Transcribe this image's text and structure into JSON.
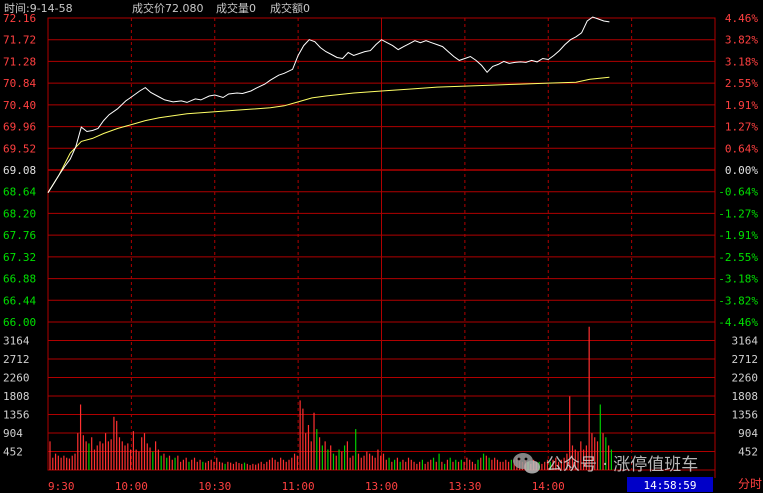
{
  "header": {
    "time_label": "时间:9-14-58",
    "price_label": "成交价72.080",
    "volume_label": "成交量0",
    "amount_label": "成交额0"
  },
  "footer": {
    "time_display": "14:58:59",
    "mode_label": "分时"
  },
  "watermark": {
    "text": "公众号 · 涨停值班车",
    "icon": "wechat-icon"
  },
  "colors": {
    "background": "#000000",
    "grid": "#b00000",
    "up": "#ff4040",
    "down": "#00e000",
    "base": "#e0e0e0",
    "price_line": "#ffffff",
    "avg_line": "#ffff66",
    "vol_up": "#ff3030",
    "vol_down": "#00d000",
    "time_box": "#0000c8"
  },
  "chart_data": {
    "type": "line",
    "base_price": 69.08,
    "price_ticks": [
      "72.16",
      "71.72",
      "71.28",
      "70.84",
      "70.40",
      "69.96",
      "69.52",
      "69.08",
      "68.64",
      "68.20",
      "67.76",
      "67.32",
      "66.88",
      "66.44",
      "66.00"
    ],
    "pct_ticks": [
      "4.46%",
      "3.82%",
      "3.18%",
      "2.55%",
      "1.91%",
      "1.27%",
      "0.64%",
      "0.00%",
      "-0.64%",
      "-1.27%",
      "-1.91%",
      "-2.55%",
      "-3.18%",
      "-3.82%",
      "-4.46%"
    ],
    "ylim": [
      66.0,
      72.16
    ],
    "volume_ticks": [
      "3164",
      "2712",
      "2260",
      "1808",
      "1356",
      "904",
      "452"
    ],
    "volume_ylim": [
      0,
      3616
    ],
    "time_ticks": [
      "9:30",
      "10:00",
      "10:30",
      "11:00",
      "13:00",
      "13:30",
      "14:00"
    ],
    "x_minutes_range": [
      0,
      240
    ],
    "series": [
      {
        "key": "price",
        "points": [
          [
            0,
            68.62
          ],
          [
            2,
            68.8
          ],
          [
            4,
            68.98
          ],
          [
            6,
            69.15
          ],
          [
            8,
            69.3
          ],
          [
            10,
            69.55
          ],
          [
            12,
            69.95
          ],
          [
            14,
            69.86
          ],
          [
            16,
            69.88
          ],
          [
            18,
            69.92
          ],
          [
            20,
            70.08
          ],
          [
            22,
            70.2
          ],
          [
            25,
            70.32
          ],
          [
            28,
            70.48
          ],
          [
            30,
            70.56
          ],
          [
            33,
            70.68
          ],
          [
            35,
            70.75
          ],
          [
            37,
            70.65
          ],
          [
            40,
            70.56
          ],
          [
            42,
            70.5
          ],
          [
            45,
            70.46
          ],
          [
            48,
            70.48
          ],
          [
            50,
            70.45
          ],
          [
            53,
            70.52
          ],
          [
            55,
            70.5
          ],
          [
            58,
            70.58
          ],
          [
            60,
            70.6
          ],
          [
            63,
            70.55
          ],
          [
            65,
            70.62
          ],
          [
            68,
            70.64
          ],
          [
            70,
            70.63
          ],
          [
            73,
            70.68
          ],
          [
            75,
            70.74
          ],
          [
            78,
            70.82
          ],
          [
            80,
            70.9
          ],
          [
            83,
            71.0
          ],
          [
            85,
            71.04
          ],
          [
            88,
            71.12
          ],
          [
            90,
            71.4
          ],
          [
            92,
            71.6
          ],
          [
            94,
            71.72
          ],
          [
            96,
            71.68
          ],
          [
            98,
            71.56
          ],
          [
            100,
            71.48
          ],
          [
            102,
            71.42
          ],
          [
            104,
            71.36
          ],
          [
            106,
            71.34
          ],
          [
            108,
            71.46
          ],
          [
            110,
            71.4
          ],
          [
            112,
            71.44
          ],
          [
            114,
            71.48
          ],
          [
            116,
            71.5
          ],
          [
            118,
            71.62
          ],
          [
            120,
            71.72
          ],
          [
            122,
            71.66
          ],
          [
            124,
            71.6
          ],
          [
            126,
            71.52
          ],
          [
            128,
            71.58
          ],
          [
            130,
            71.64
          ],
          [
            132,
            71.7
          ],
          [
            134,
            71.66
          ],
          [
            136,
            71.7
          ],
          [
            138,
            71.66
          ],
          [
            140,
            71.62
          ],
          [
            142,
            71.58
          ],
          [
            144,
            71.48
          ],
          [
            146,
            71.38
          ],
          [
            148,
            71.3
          ],
          [
            150,
            71.34
          ],
          [
            152,
            71.38
          ],
          [
            154,
            71.3
          ],
          [
            156,
            71.2
          ],
          [
            158,
            71.06
          ],
          [
            160,
            71.18
          ],
          [
            162,
            71.22
          ],
          [
            164,
            71.28
          ],
          [
            166,
            71.24
          ],
          [
            168,
            71.26
          ],
          [
            170,
            71.27
          ],
          [
            172,
            71.26
          ],
          [
            174,
            71.3
          ],
          [
            176,
            71.27
          ],
          [
            178,
            71.34
          ],
          [
            180,
            71.32
          ],
          [
            182,
            71.4
          ],
          [
            184,
            71.5
          ],
          [
            186,
            71.62
          ],
          [
            188,
            71.72
          ],
          [
            190,
            71.78
          ],
          [
            192,
            71.86
          ],
          [
            194,
            72.1
          ],
          [
            196,
            72.18
          ],
          [
            198,
            72.14
          ],
          [
            200,
            72.1
          ],
          [
            202,
            72.08
          ]
        ]
      },
      {
        "key": "average",
        "points": [
          [
            0,
            68.62
          ],
          [
            4,
            68.98
          ],
          [
            8,
            69.42
          ],
          [
            12,
            69.66
          ],
          [
            16,
            69.72
          ],
          [
            20,
            69.82
          ],
          [
            25,
            69.92
          ],
          [
            30,
            70.0
          ],
          [
            35,
            70.08
          ],
          [
            40,
            70.14
          ],
          [
            50,
            70.22
          ],
          [
            60,
            70.26
          ],
          [
            70,
            70.3
          ],
          [
            80,
            70.34
          ],
          [
            85,
            70.38
          ],
          [
            90,
            70.46
          ],
          [
            95,
            70.54
          ],
          [
            100,
            70.58
          ],
          [
            110,
            70.64
          ],
          [
            120,
            70.68
          ],
          [
            130,
            70.72
          ],
          [
            140,
            70.76
          ],
          [
            150,
            70.78
          ],
          [
            160,
            70.8
          ],
          [
            170,
            70.82
          ],
          [
            180,
            70.84
          ],
          [
            190,
            70.86
          ],
          [
            195,
            70.92
          ],
          [
            202,
            70.96
          ]
        ]
      }
    ],
    "volume_bars": [
      [
        0,
        700
      ],
      [
        1,
        300
      ],
      [
        2,
        400
      ],
      [
        3,
        350
      ],
      [
        4,
        300
      ],
      [
        5,
        350
      ],
      [
        6,
        300
      ],
      [
        7,
        280
      ],
      [
        8,
        350
      ],
      [
        9,
        400
      ],
      [
        10,
        900
      ],
      [
        11,
        1600
      ],
      [
        12,
        850
      ],
      [
        13,
        700
      ],
      [
        14,
        650
      ],
      [
        15,
        800
      ],
      [
        16,
        500
      ],
      [
        17,
        600
      ],
      [
        18,
        700
      ],
      [
        19,
        650
      ],
      [
        20,
        900
      ],
      [
        21,
        700
      ],
      [
        22,
        750
      ],
      [
        23,
        1300
      ],
      [
        24,
        1200
      ],
      [
        25,
        800
      ],
      [
        26,
        700
      ],
      [
        27,
        600
      ],
      [
        28,
        650
      ],
      [
        29,
        500
      ],
      [
        30,
        950
      ],
      [
        31,
        500
      ],
      [
        32,
        450
      ],
      [
        33,
        800
      ],
      [
        34,
        900
      ],
      [
        35,
        650
      ],
      [
        36,
        550
      ],
      [
        37,
        450
      ],
      [
        38,
        700
      ],
      [
        39,
        500
      ],
      [
        40,
        350
      ],
      [
        41,
        400
      ],
      [
        42,
        300
      ],
      [
        43,
        350
      ],
      [
        44,
        250
      ],
      [
        45,
        300
      ],
      [
        46,
        350
      ],
      [
        47,
        200
      ],
      [
        48,
        250
      ],
      [
        49,
        300
      ],
      [
        50,
        200
      ],
      [
        51,
        250
      ],
      [
        52,
        300
      ],
      [
        53,
        200
      ],
      [
        54,
        250
      ],
      [
        55,
        200
      ],
      [
        56,
        180
      ],
      [
        57,
        220
      ],
      [
        58,
        250
      ],
      [
        59,
        200
      ],
      [
        60,
        300
      ],
      [
        61,
        200
      ],
      [
        62,
        180
      ],
      [
        63,
        150
      ],
      [
        64,
        200
      ],
      [
        65,
        180
      ],
      [
        66,
        150
      ],
      [
        67,
        200
      ],
      [
        68,
        170
      ],
      [
        69,
        150
      ],
      [
        70,
        180
      ],
      [
        71,
        150
      ],
      [
        72,
        120
      ],
      [
        73,
        150
      ],
      [
        74,
        130
      ],
      [
        75,
        160
      ],
      [
        76,
        200
      ],
      [
        77,
        150
      ],
      [
        78,
        200
      ],
      [
        79,
        250
      ],
      [
        80,
        300
      ],
      [
        81,
        250
      ],
      [
        82,
        200
      ],
      [
        83,
        300
      ],
      [
        84,
        250
      ],
      [
        85,
        200
      ],
      [
        86,
        250
      ],
      [
        87,
        300
      ],
      [
        88,
        400
      ],
      [
        89,
        350
      ],
      [
        90,
        1700
      ],
      [
        91,
        1500
      ],
      [
        92,
        900
      ],
      [
        93,
        1100
      ],
      [
        94,
        700
      ],
      [
        95,
        1400
      ],
      [
        96,
        1000
      ],
      [
        97,
        800
      ],
      [
        98,
        600
      ],
      [
        99,
        700
      ],
      [
        100,
        500
      ],
      [
        101,
        600
      ],
      [
        102,
        400
      ],
      [
        103,
        350
      ],
      [
        104,
        500
      ],
      [
        105,
        450
      ],
      [
        106,
        600
      ],
      [
        107,
        700
      ],
      [
        108,
        300
      ],
      [
        109,
        350
      ],
      [
        110,
        1000
      ],
      [
        111,
        400
      ],
      [
        112,
        300
      ],
      [
        113,
        350
      ],
      [
        114,
        450
      ],
      [
        115,
        400
      ],
      [
        116,
        350
      ],
      [
        117,
        300
      ],
      [
        118,
        500
      ],
      [
        119,
        350
      ],
      [
        120,
        400
      ],
      [
        121,
        250
      ],
      [
        122,
        300
      ],
      [
        123,
        200
      ],
      [
        124,
        250
      ],
      [
        125,
        300
      ],
      [
        126,
        200
      ],
      [
        127,
        250
      ],
      [
        128,
        200
      ],
      [
        129,
        300
      ],
      [
        130,
        250
      ],
      [
        131,
        200
      ],
      [
        132,
        150
      ],
      [
        133,
        200
      ],
      [
        134,
        250
      ],
      [
        135,
        150
      ],
      [
        136,
        200
      ],
      [
        137,
        250
      ],
      [
        138,
        300
      ],
      [
        139,
        200
      ],
      [
        140,
        400
      ],
      [
        141,
        200
      ],
      [
        142,
        150
      ],
      [
        143,
        250
      ],
      [
        144,
        300
      ],
      [
        145,
        200
      ],
      [
        146,
        250
      ],
      [
        147,
        200
      ],
      [
        148,
        250
      ],
      [
        149,
        200
      ],
      [
        150,
        300
      ],
      [
        151,
        250
      ],
      [
        152,
        200
      ],
      [
        153,
        150
      ],
      [
        154,
        250
      ],
      [
        155,
        300
      ],
      [
        156,
        400
      ],
      [
        157,
        350
      ],
      [
        158,
        300
      ],
      [
        159,
        250
      ],
      [
        160,
        300
      ],
      [
        161,
        250
      ],
      [
        162,
        200
      ],
      [
        163,
        200
      ],
      [
        164,
        250
      ],
      [
        165,
        200
      ],
      [
        166,
        250
      ],
      [
        167,
        250
      ],
      [
        168,
        300
      ],
      [
        169,
        300
      ],
      [
        170,
        200
      ],
      [
        171,
        250
      ],
      [
        172,
        200
      ],
      [
        173,
        150
      ],
      [
        174,
        250
      ],
      [
        175,
        200
      ],
      [
        176,
        200
      ],
      [
        177,
        150
      ],
      [
        178,
        200
      ],
      [
        179,
        250
      ],
      [
        180,
        200
      ],
      [
        181,
        250
      ],
      [
        182,
        300
      ],
      [
        183,
        200
      ],
      [
        184,
        250
      ],
      [
        185,
        300
      ],
      [
        186,
        400
      ],
      [
        187,
        1800
      ],
      [
        188,
        600
      ],
      [
        189,
        500
      ],
      [
        190,
        450
      ],
      [
        191,
        700
      ],
      [
        192,
        500
      ],
      [
        193,
        600
      ],
      [
        194,
        3500
      ],
      [
        195,
        900
      ],
      [
        196,
        800
      ],
      [
        197,
        700
      ],
      [
        198,
        1600
      ],
      [
        199,
        900
      ],
      [
        200,
        800
      ],
      [
        201,
        600
      ],
      [
        202,
        500
      ]
    ]
  }
}
